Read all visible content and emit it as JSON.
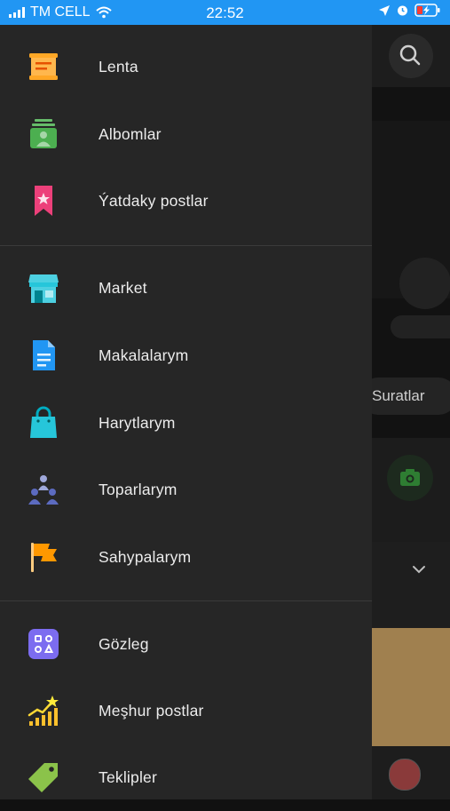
{
  "status_bar": {
    "carrier": "TM CELL",
    "time": "22:52"
  },
  "background_screen": {
    "tab_label": "Suratlar"
  },
  "drawer": {
    "items": [
      {
        "label": "Lenta",
        "icon": "feed-icon"
      },
      {
        "label": "Albomlar",
        "icon": "albums-icon"
      },
      {
        "label": "Ýatdaky postlar",
        "icon": "bookmark-star-icon"
      },
      {
        "label": "Market",
        "icon": "store-icon"
      },
      {
        "label": "Makalalarym",
        "icon": "document-icon"
      },
      {
        "label": "Harytlarym",
        "icon": "shopping-bag-icon"
      },
      {
        "label": "Toparlarym",
        "icon": "groups-icon"
      },
      {
        "label": "Sahypalarym",
        "icon": "flag-icon"
      },
      {
        "label": "Gözleg",
        "icon": "explore-icon"
      },
      {
        "label": "Meşhur postlar",
        "icon": "trending-icon"
      },
      {
        "label": "Teklipler",
        "icon": "tag-icon"
      }
    ]
  },
  "colors": {
    "status_bar": "#2196f3",
    "drawer_bg": "#262626",
    "label_text": "#ececec"
  }
}
